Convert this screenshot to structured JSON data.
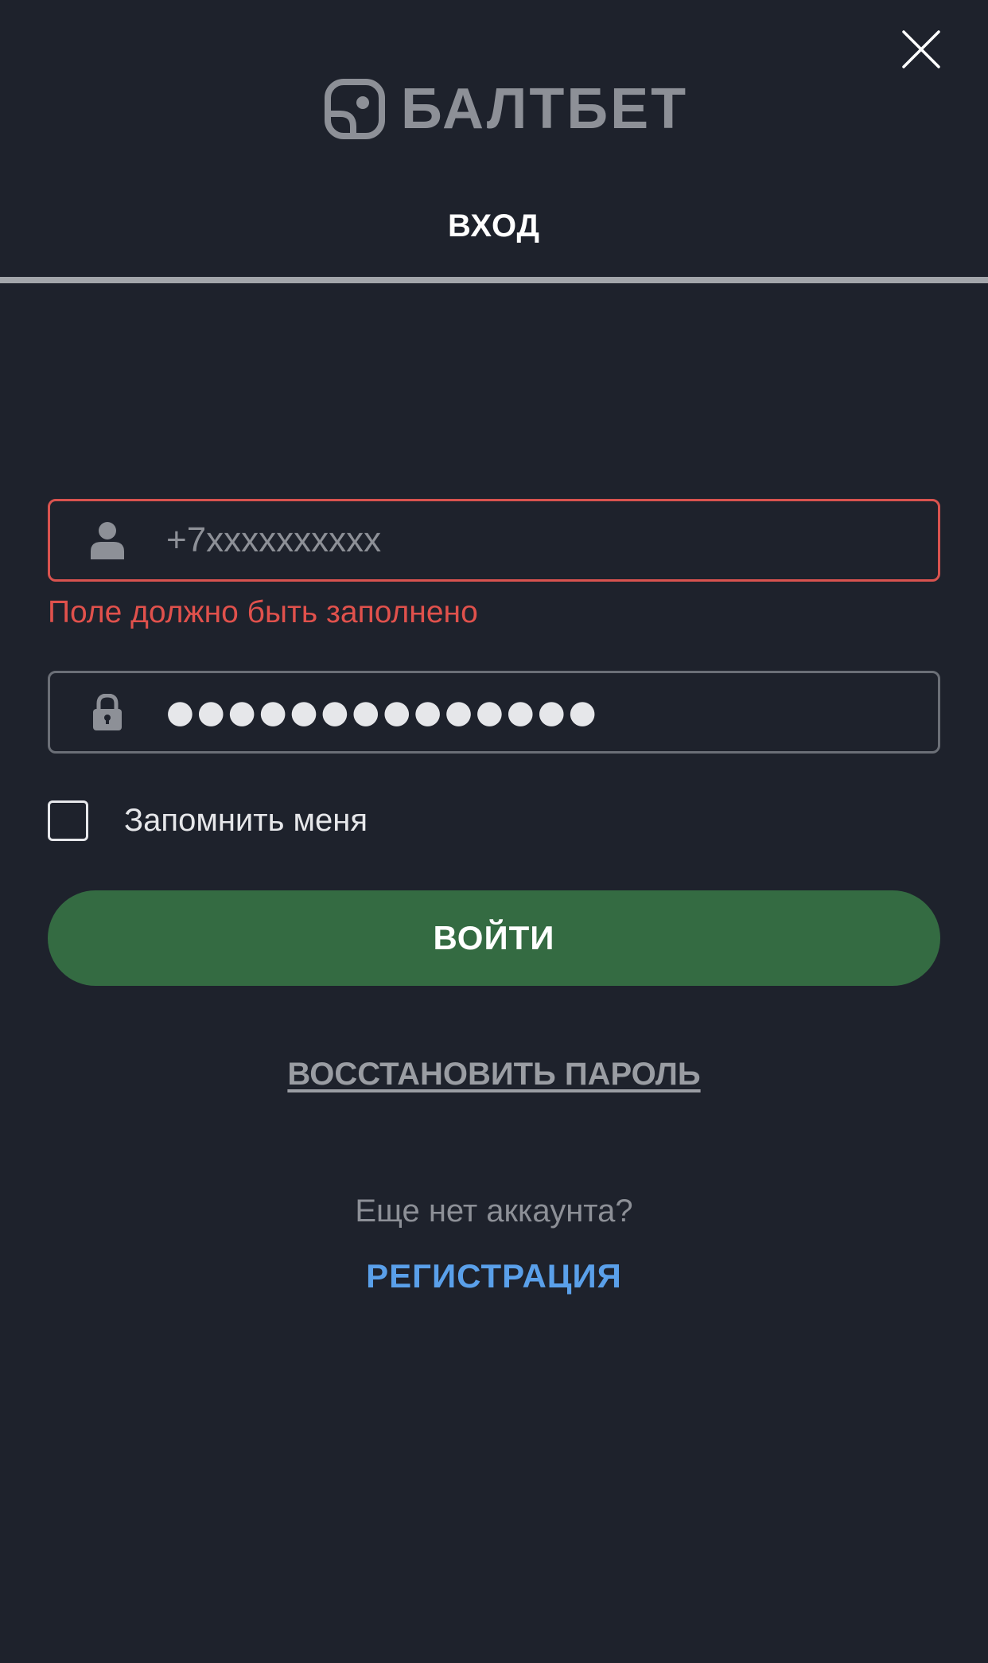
{
  "header": {
    "close_icon": "close-icon",
    "logo_text": "БАЛТБЕТ",
    "logo_icon": "baltbet-logo-icon"
  },
  "tabs": [
    {
      "label": "ВХОД",
      "active": true
    }
  ],
  "form": {
    "phone": {
      "icon": "user-icon",
      "placeholder": "+7xxxxxxxxxx",
      "value": "",
      "error": "Поле должно быть заполнено"
    },
    "password": {
      "icon": "lock-icon",
      "masked_value": "●●●●●●●●●●●●●●"
    },
    "remember_me": {
      "label": "Запомнить меня",
      "checked": false
    },
    "submit_label": "ВОЙТИ",
    "restore_password_label": "ВОССТАНОВИТЬ ПАРОЛЬ"
  },
  "footer": {
    "no_account_text": "Еще нет аккаунта?",
    "register_label": "РЕГИСТРАЦИЯ"
  },
  "colors": {
    "background": "#1e222c",
    "error": "#e0514c",
    "primary_button": "#346b42",
    "link": "#5aa0ea",
    "muted": "#8d9097"
  }
}
